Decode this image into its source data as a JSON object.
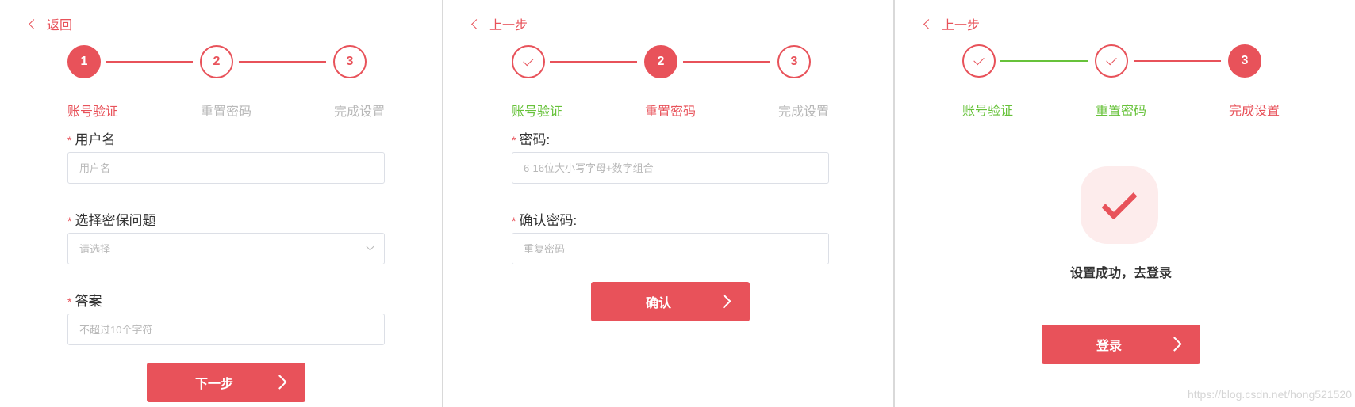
{
  "panel1": {
    "back_label": "返回",
    "steps": [
      {
        "label": "账号验证",
        "number": "1",
        "state": "active"
      },
      {
        "label": "重置密码",
        "number": "2",
        "state": "pending"
      },
      {
        "label": "完成设置",
        "number": "3",
        "state": "pending"
      }
    ],
    "fields": {
      "username_label": "用户名",
      "username_placeholder": "用户名",
      "question_label": "选择密保问题",
      "question_placeholder": "请选择",
      "answer_label": "答案",
      "answer_placeholder": "不超过10个字符"
    },
    "next_button": "下一步"
  },
  "panel2": {
    "back_label": "上一步",
    "steps": [
      {
        "label": "账号验证",
        "number": "",
        "state": "done"
      },
      {
        "label": "重置密码",
        "number": "2",
        "state": "active"
      },
      {
        "label": "完成设置",
        "number": "3",
        "state": "pending"
      }
    ],
    "fields": {
      "password_label": "密码:",
      "password_placeholder": "6-16位大小写字母+数字组合",
      "confirm_label": "确认密码:",
      "confirm_placeholder": "重复密码"
    },
    "confirm_button": "确认"
  },
  "panel3": {
    "back_label": "上一步",
    "steps": [
      {
        "label": "账号验证",
        "number": "",
        "state": "done"
      },
      {
        "label": "重置密码",
        "number": "",
        "state": "done"
      },
      {
        "label": "完成设置",
        "number": "3",
        "state": "active"
      }
    ],
    "success_message": "设置成功，去登录",
    "login_button": "登录"
  },
  "watermark": "https://blog.csdn.net/hong521520",
  "colors": {
    "accent": "#e8525a",
    "done_green": "#67c23a",
    "inactive_gray": "#b8b8b8",
    "success_bg": "#fdecec"
  }
}
